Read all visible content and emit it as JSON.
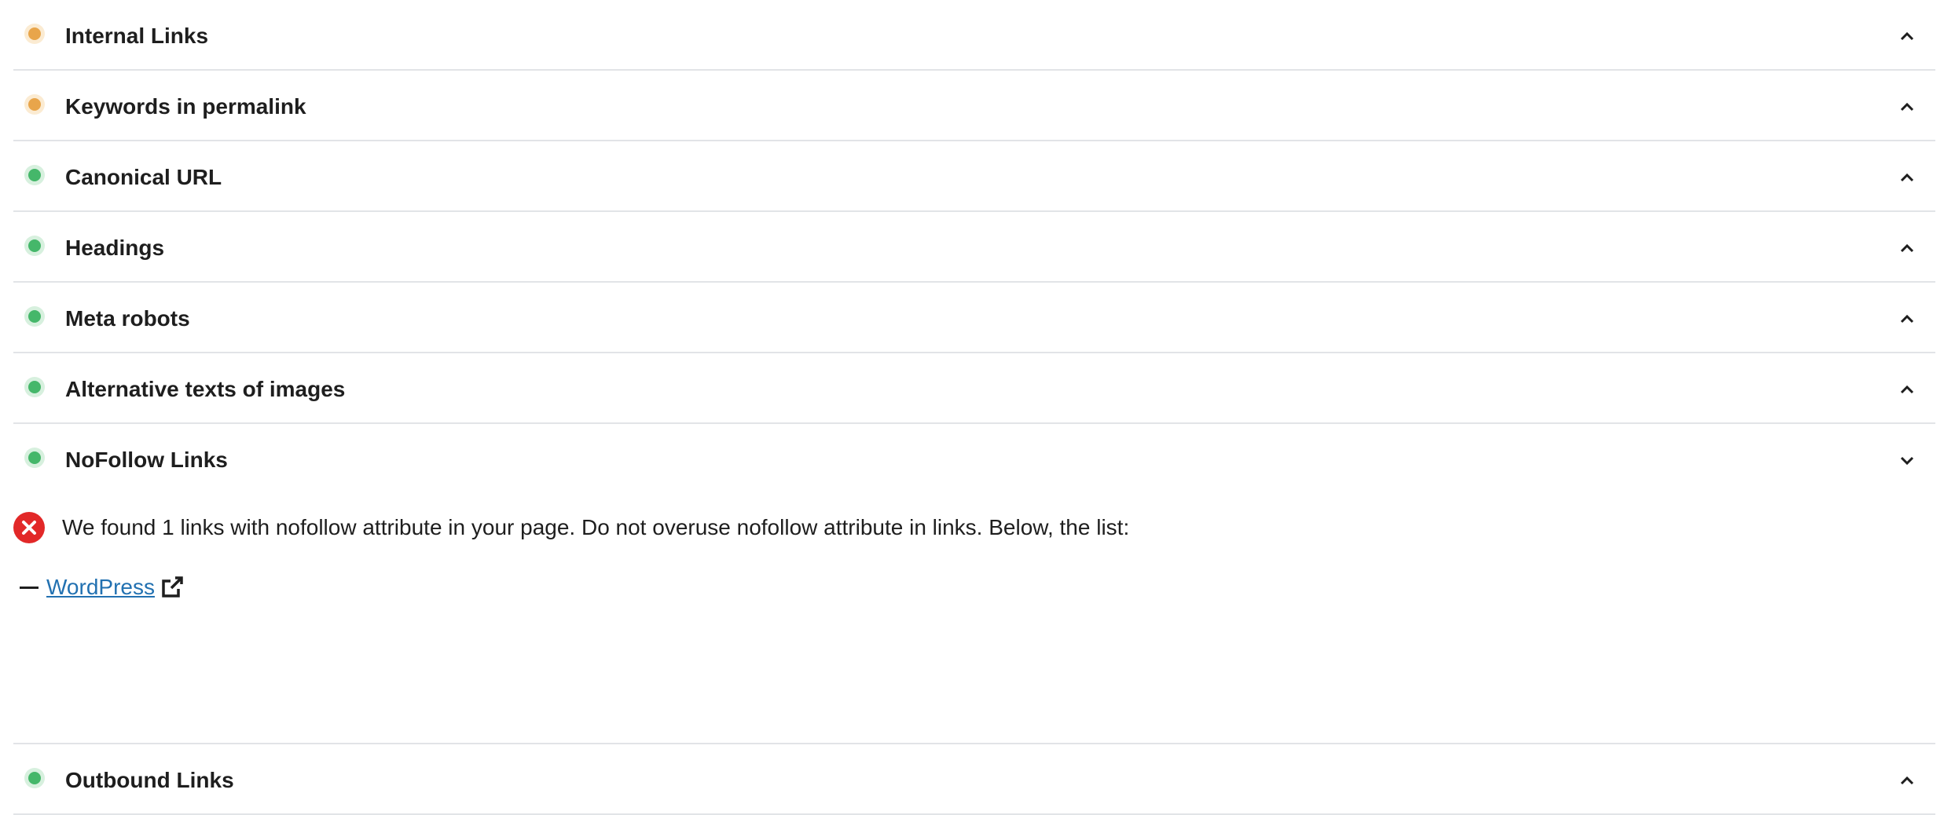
{
  "sections": [
    {
      "title": "Internal Links",
      "status_color": "#e8a54b",
      "expanded": false
    },
    {
      "title": "Keywords in permalink",
      "status_color": "#e8a54b",
      "expanded": false
    },
    {
      "title": "Canonical URL",
      "status_color": "#45b76a",
      "expanded": false
    },
    {
      "title": "Headings",
      "status_color": "#45b76a",
      "expanded": false
    },
    {
      "title": "Meta robots",
      "status_color": "#45b76a",
      "expanded": false
    },
    {
      "title": "Alternative texts of images",
      "status_color": "#45b76a",
      "expanded": false
    },
    {
      "title": "NoFollow Links",
      "status_color": "#45b76a",
      "expanded": true
    },
    {
      "title": "Outbound Links",
      "status_color": "#45b76a",
      "expanded": false
    }
  ],
  "nofollow": {
    "message": "We found 1 links with nofollow attribute in your page. Do not overuse nofollow attribute in links. Below, the list:",
    "status_icon": "error-icon",
    "error_color": "#e22828",
    "links": [
      {
        "text": "WordPress",
        "icon": "external-link-icon"
      }
    ]
  },
  "colors": {
    "link": "#2271b1",
    "divider": "#e2e4e7",
    "warning": "#e8a54b",
    "good": "#45b76a"
  }
}
